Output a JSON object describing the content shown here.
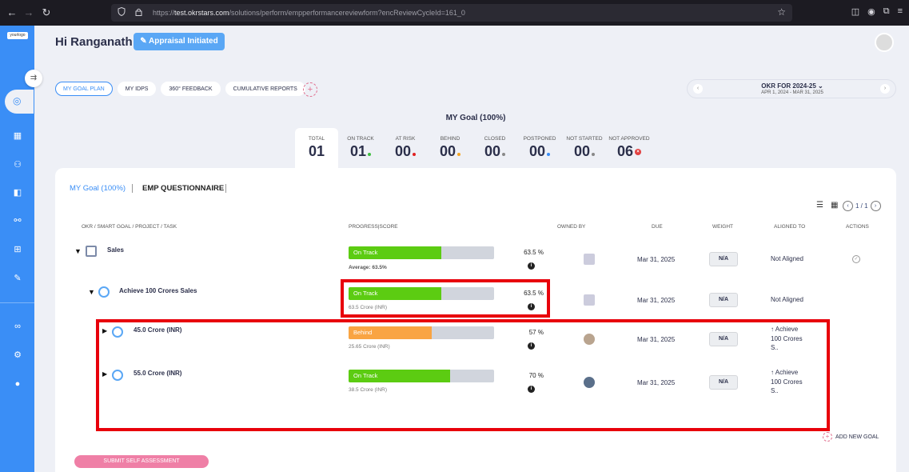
{
  "browser": {
    "back_icon": "←",
    "forward_icon": "→",
    "reload_icon": "↻",
    "url_prefix": "https://",
    "url_host": "test.okrstars.com",
    "url_path": "/solutions/perform/empperformancereviewform?encReviewCycleId=161_0"
  },
  "sidebar": {
    "logo": "yourlogo"
  },
  "header": {
    "greeting": "Hi Ranganath",
    "status_button": "Appraisal Initiated"
  },
  "tabs": [
    "MY GOAL PLAN",
    "MY IDPS",
    "360° FEEDBACK",
    "CUMULATIVE REPORTS"
  ],
  "period": {
    "title": "OKR FOR 2024-25",
    "range": "APR 1, 2024 - MAR 31, 2025"
  },
  "summary": {
    "title": "MY Goal (100%)",
    "stats": [
      {
        "label": "TOTAL",
        "value": "01"
      },
      {
        "label": "ON TRACK",
        "value": "01",
        "color": "#3fbf3f"
      },
      {
        "label": "AT RISK",
        "value": "00",
        "color": "#e02020"
      },
      {
        "label": "BEHIND",
        "value": "00",
        "color": "#f5a623"
      },
      {
        "label": "CLOSED",
        "value": "00",
        "color": "#888888"
      },
      {
        "label": "POSTPONED",
        "value": "00",
        "color": "#3a8ef6"
      },
      {
        "label": "NOT STARTED",
        "value": "00",
        "color": "#888888"
      },
      {
        "label": "NOT APPROVED",
        "value": "06",
        "color": "#e24040"
      }
    ]
  },
  "panel": {
    "tab_goal": "MY Goal (100%)",
    "tab_questionnaire": "EMP QUESTIONNAIRE",
    "pager": "1 / 1",
    "columns": {
      "okr": "OKR / SMART GOAL / PROJECT / TASK",
      "progress": "PROGRESS|SCORE",
      "owned": "OWNED BY",
      "due": "DUE",
      "weight": "WEIGHT",
      "aligned": "ALIGNED TO",
      "actions": "ACTIONS"
    },
    "rows": [
      {
        "name": "Sales",
        "status": "On Track",
        "progress": 0.635,
        "color": "#5ccc12",
        "pct": "63.5",
        "sub": "Average: 63.5%",
        "due": "Mar 31, 2025",
        "weight": "N/A",
        "aligned": "Not Aligned"
      },
      {
        "name": "Achieve 100 Crores Sales",
        "status": "On Track",
        "progress": 0.635,
        "color": "#5ccc12",
        "pct": "63.5",
        "sub": "63.5 Crore (INR)",
        "due": "Mar 31, 2025",
        "weight": "N/A",
        "aligned": "Not Aligned"
      },
      {
        "name": "45.0 Crore (INR)",
        "status": "Behind",
        "progress": 0.57,
        "color": "#f9a443",
        "pct": "57",
        "sub": "25.65 Crore (INR)",
        "due": "Mar 31, 2025",
        "weight": "N/A",
        "aligned1": "↑ Achieve",
        "aligned2": "100 Crores",
        "aligned3": "S.."
      },
      {
        "name": "55.0 Crore (INR)",
        "status": "On Track",
        "progress": 0.7,
        "color": "#5ccc12",
        "pct": "70",
        "sub": "38.5 Crore (INR)",
        "due": "Mar 31, 2025",
        "weight": "N/A",
        "aligned1": "↑ Achieve",
        "aligned2": "100 Crores",
        "aligned3": "S.."
      }
    ],
    "pct_suffix": "%",
    "add_goal": "ADD NEW GOAL",
    "submit": "SUBMIT SELF ASSESSMENT"
  }
}
